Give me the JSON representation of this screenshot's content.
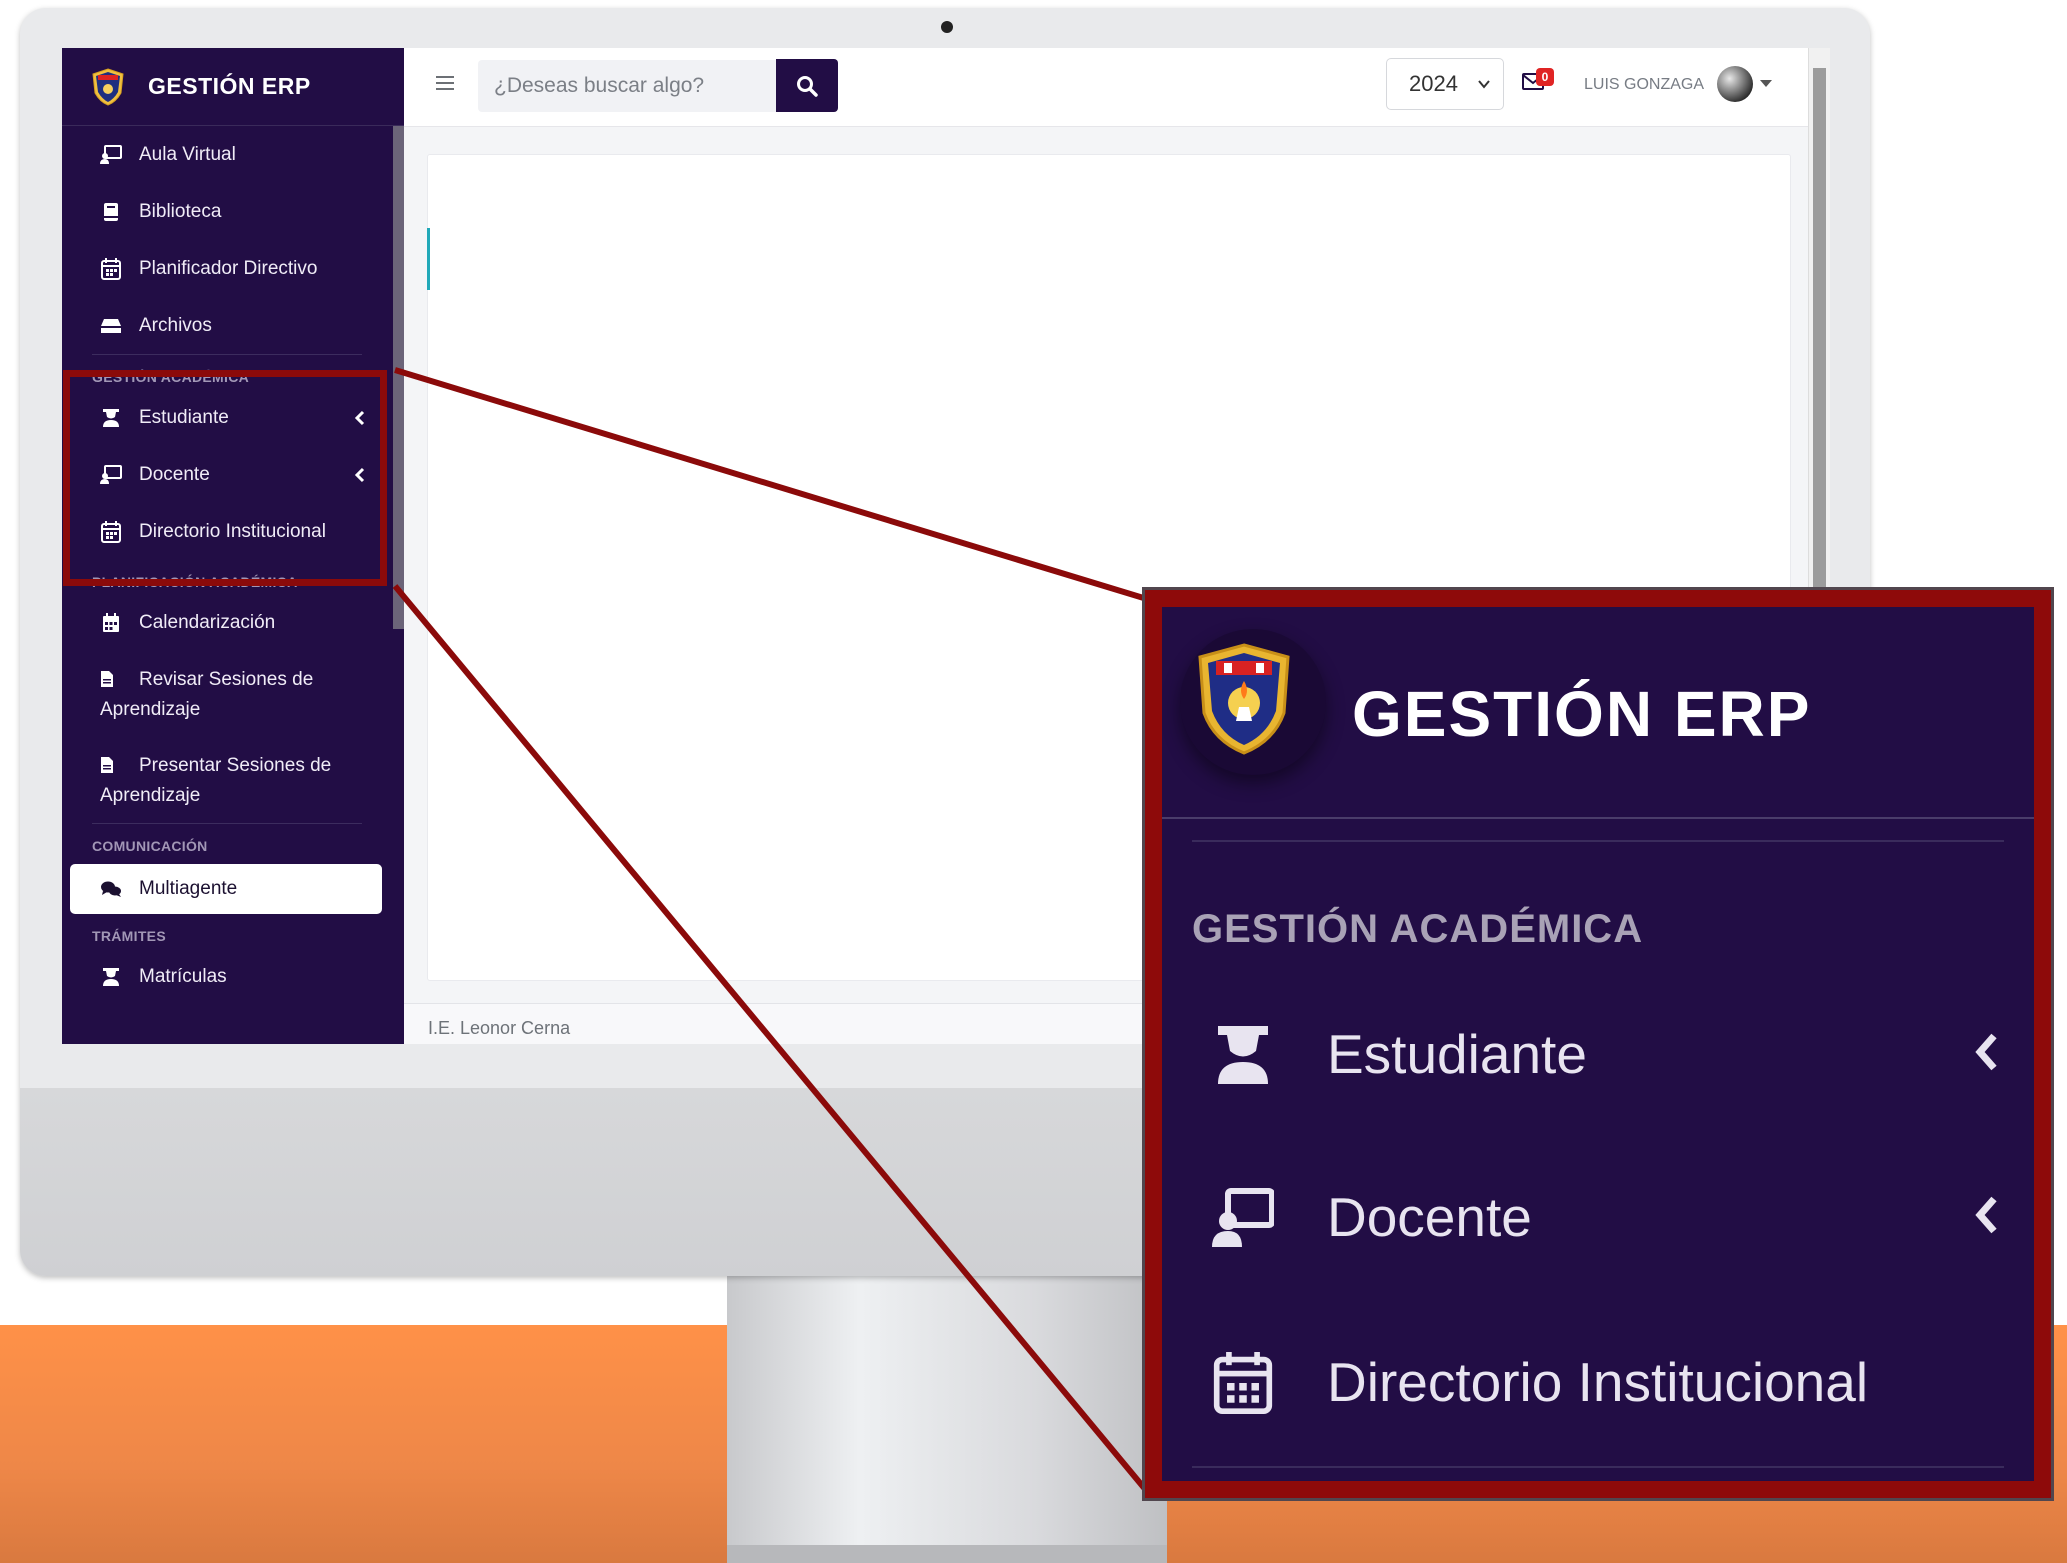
{
  "colors": {
    "sidebar_bg": "#220d45",
    "highlight": "#8b0a0a",
    "background_band": "#ff9148",
    "badge": "#e02424"
  },
  "sidebar": {
    "brand": "GESTIÓN ERP",
    "items_top": [
      {
        "label": "Aula Virtual",
        "icon": "chalkboard-teacher-icon"
      },
      {
        "label": "Biblioteca",
        "icon": "book-icon"
      },
      {
        "label": "Planificador Directivo",
        "icon": "calendar-icon"
      },
      {
        "label": "Archivos",
        "icon": "hdd-icon"
      }
    ],
    "section_academica": "GESTIÓN ACADÉMICA",
    "items_academica": [
      {
        "label": "Estudiante",
        "icon": "student-icon",
        "expandable": true
      },
      {
        "label": "Docente",
        "icon": "chalkboard-teacher-icon",
        "expandable": true
      },
      {
        "label": "Directorio Institucional",
        "icon": "calendar-icon"
      }
    ],
    "section_planificacion": "PLANIFICACIÓN ACADÉMICA",
    "items_planificacion": [
      {
        "label": "Calendarización",
        "icon": "calendar-icon"
      },
      {
        "label": "Revisar Sesiones de Aprendizaje",
        "icon": "file-icon"
      },
      {
        "label": "Presentar Sesiones de Aprendizaje",
        "icon": "file-icon"
      }
    ],
    "section_comunicacion": "COMUNICACIÓN",
    "items_comunicacion": [
      {
        "label": "Multiagente",
        "icon": "comments-icon",
        "active": true
      }
    ],
    "section_tramites": "TRÁMITES",
    "items_tramites": [
      {
        "label": "Matrículas",
        "icon": "student-icon"
      }
    ]
  },
  "topbar": {
    "search_placeholder": "¿Deseas buscar algo?",
    "year": "2024",
    "mail_count": "0",
    "user_name": "LUIS GONZAGA"
  },
  "footer": {
    "text": "I.E. Leonor Cerna"
  },
  "zoom": {
    "brand": "GESTIÓN ERP",
    "section": "GESTIÓN ACADÉMICA",
    "items": [
      {
        "label": "Estudiante",
        "icon": "student-icon"
      },
      {
        "label": "Docente",
        "icon": "chalkboard-teacher-icon"
      },
      {
        "label": "Directorio Institucional",
        "icon": "calendar-icon"
      }
    ]
  }
}
